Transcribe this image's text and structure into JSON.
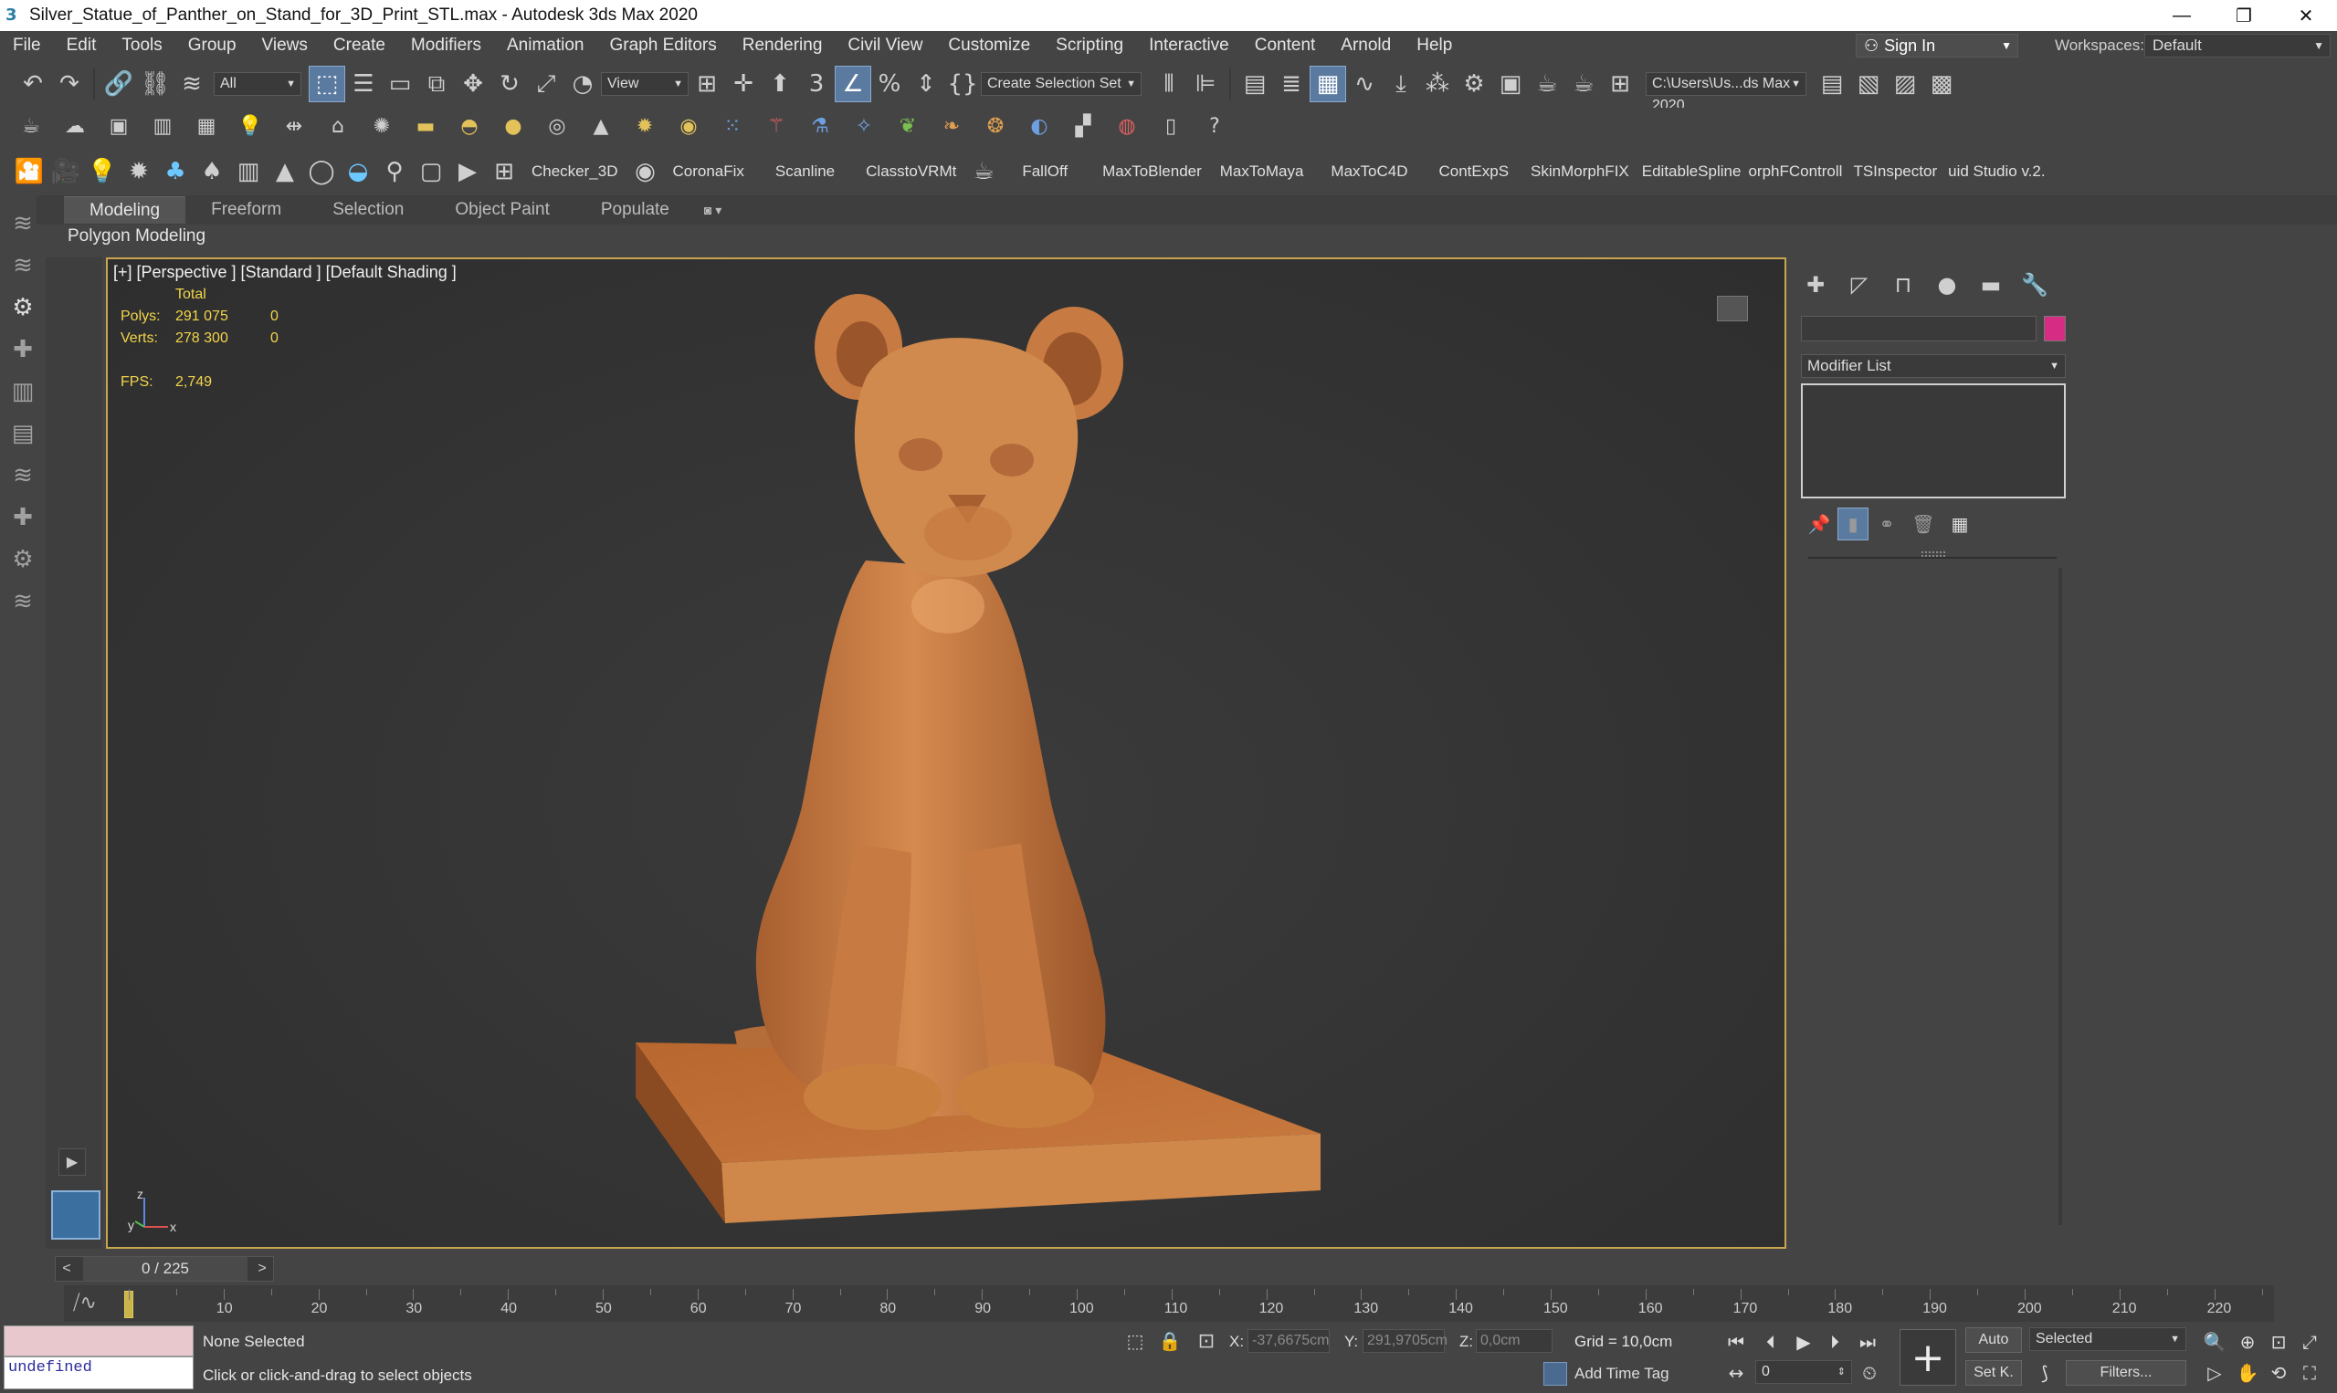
{
  "window": {
    "title": "Silver_Statue_of_Panther_on_Stand_for_3D_Print_STL.max - Autodesk 3ds Max 2020",
    "minimize": "—",
    "restore": "❐",
    "close": "✕"
  },
  "menu": {
    "items": [
      "File",
      "Edit",
      "Tools",
      "Group",
      "Views",
      "Create",
      "Modifiers",
      "Animation",
      "Graph Editors",
      "Rendering",
      "Civil View",
      "Customize",
      "Scripting",
      "Interactive",
      "Content",
      "Arnold",
      "Help"
    ],
    "sign_in": "Sign In",
    "workspaces_label": "Workspaces:",
    "workspace_value": "Default"
  },
  "toolbar1": {
    "selection_filter": "All",
    "ref_coord": "View",
    "named_selection": "Create Selection Set",
    "project_path": "C:\\Users\\Us...ds Max 2020"
  },
  "toolbar3": {
    "scripts": [
      "Checker_3D",
      "CoronaFix",
      "Scanline",
      "ClasstoVRMt",
      "FallOff",
      "MaxToBlender",
      "MaxToMaya",
      "MaxToC4D",
      "ContExpS",
      "SkinMorphFIX",
      "EditableSpline",
      "orphFControll",
      "TSInspector",
      "uid Studio v.2."
    ]
  },
  "ribbon": {
    "tabs": [
      "Modeling",
      "Freeform",
      "Selection",
      "Object Paint",
      "Populate"
    ],
    "active_tab": "Modeling",
    "panel_label": "Polygon Modeling"
  },
  "viewport": {
    "label": "[+] [Perspective ] [Standard ] [Default Shading ]",
    "stats": {
      "total_label": "Total",
      "polys_label": "Polys:",
      "polys_total": "291 075",
      "polys_sel": "0",
      "verts_label": "Verts:",
      "verts_total": "278 300",
      "verts_sel": "0",
      "fps_label": "FPS:",
      "fps_value": "2,749"
    },
    "axis": {
      "x": "x",
      "y": "y",
      "z": "z"
    },
    "model_color": "#c87840"
  },
  "command_panel": {
    "modifier_list": "Modifier List",
    "object_color": "#d62c84"
  },
  "timeline": {
    "frame_display": "0 / 225",
    "prev": "<",
    "next": ">",
    "ticks": [
      "10",
      "20",
      "30",
      "40",
      "50",
      "60",
      "70",
      "80",
      "90",
      "100",
      "110",
      "120",
      "130",
      "140",
      "150",
      "160",
      "170",
      "180",
      "190",
      "200",
      "210",
      "220"
    ]
  },
  "status": {
    "maxscript_output": "undefined",
    "selection": "None Selected",
    "prompt": "Click or click-and-drag to select objects",
    "x_label": "X:",
    "x_value": "-37,6675cm",
    "y_label": "Y:",
    "y_value": "291,9705cm",
    "z_label": "Z:",
    "z_value": "0,0cm",
    "grid": "Grid = 10,0cm",
    "add_time_tag": "Add Time Tag",
    "auto_key": "Auto",
    "set_key": "Set K.",
    "key_filter_value": "Selected",
    "filters": "Filters...",
    "current_frame": "0"
  }
}
